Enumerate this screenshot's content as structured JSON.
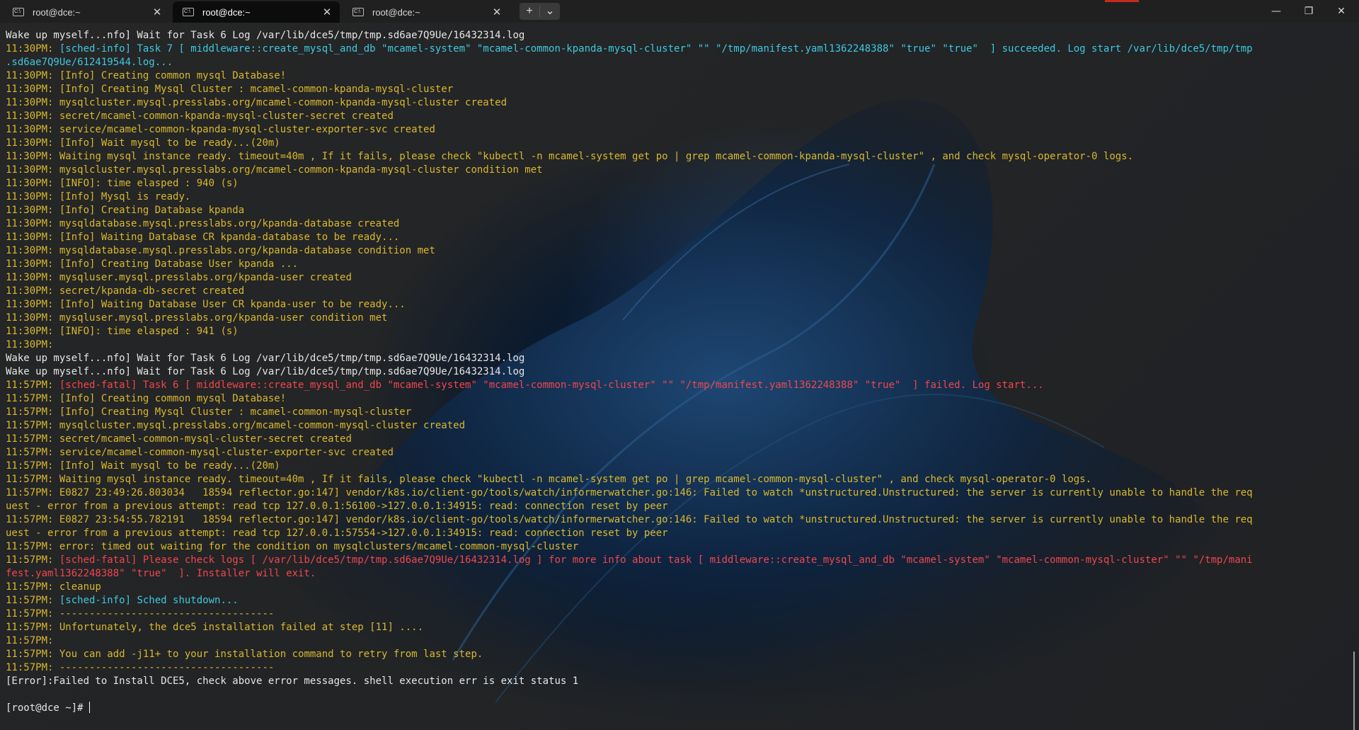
{
  "tabs": [
    {
      "label": "root@dce:~",
      "active": false
    },
    {
      "label": "root@dce:~",
      "active": true
    },
    {
      "label": "root@dce:~",
      "active": false
    }
  ],
  "controls": {
    "new_tab": "+",
    "dropdown": "⌄",
    "minimize": "—",
    "maximize": "❐",
    "close": "✕",
    "tab_close": "✕"
  },
  "terminal_lines": [
    {
      "time": "",
      "text": "Wake up myself...nfo] Wait for Task 6 Log /var/lib/dce5/tmp/tmp.sd6ae7Q9Ue/16432314.log",
      "color": "white"
    },
    {
      "time": "11:30PM:",
      "text": " [sched-info] Task 7 [ middleware::create_mysql_and_db \"mcamel-system\" \"mcamel-common-kpanda-mysql-cluster\" \"\" \"/tmp/manifest.yaml1362248388\" \"true\" \"true\"  ] succeeded. Log start /var/lib/dce5/tmp/tmp",
      "color": "cyan"
    },
    {
      "time": "",
      "text": ".sd6ae7Q9Ue/612419544.log...",
      "color": "cyan"
    },
    {
      "time": "11:30PM:",
      "text": " [Info] Creating common mysql Database!",
      "color": "yellow"
    },
    {
      "time": "11:30PM:",
      "text": " [Info] Creating Mysql Cluster : mcamel-common-kpanda-mysql-cluster",
      "color": "yellow"
    },
    {
      "time": "11:30PM:",
      "text": " mysqlcluster.mysql.presslabs.org/mcamel-common-kpanda-mysql-cluster created",
      "color": "yellow"
    },
    {
      "time": "11:30PM:",
      "text": " secret/mcamel-common-kpanda-mysql-cluster-secret created",
      "color": "yellow"
    },
    {
      "time": "11:30PM:",
      "text": " service/mcamel-common-kpanda-mysql-cluster-exporter-svc created",
      "color": "yellow"
    },
    {
      "time": "11:30PM:",
      "text": " [Info] Wait mysql to be ready...(20m)",
      "color": "yellow"
    },
    {
      "time": "11:30PM:",
      "text": " Waiting mysql instance ready. timeout=40m , If it fails, please check \"kubectl -n mcamel-system get po | grep mcamel-common-kpanda-mysql-cluster\" , and check mysql-operator-0 logs.",
      "color": "yellow"
    },
    {
      "time": "11:30PM:",
      "text": " mysqlcluster.mysql.presslabs.org/mcamel-common-kpanda-mysql-cluster condition met",
      "color": "yellow"
    },
    {
      "time": "11:30PM:",
      "text": " [INFO]: time elasped : 940 (s)",
      "color": "yellow"
    },
    {
      "time": "11:30PM:",
      "text": " [Info] Mysql is ready.",
      "color": "yellow"
    },
    {
      "time": "11:30PM:",
      "text": " [Info] Creating Database kpanda",
      "color": "yellow"
    },
    {
      "time": "11:30PM:",
      "text": " mysqldatabase.mysql.presslabs.org/kpanda-database created",
      "color": "yellow"
    },
    {
      "time": "11:30PM:",
      "text": " [Info] Waiting Database CR kpanda-database to be ready...",
      "color": "yellow"
    },
    {
      "time": "11:30PM:",
      "text": " mysqldatabase.mysql.presslabs.org/kpanda-database condition met",
      "color": "yellow"
    },
    {
      "time": "11:30PM:",
      "text": " [Info] Creating Database User kpanda ...",
      "color": "yellow"
    },
    {
      "time": "11:30PM:",
      "text": " mysqluser.mysql.presslabs.org/kpanda-user created",
      "color": "yellow"
    },
    {
      "time": "11:30PM:",
      "text": " secret/kpanda-db-secret created",
      "color": "yellow"
    },
    {
      "time": "11:30PM:",
      "text": " [Info] Waiting Database User CR kpanda-user to be ready...",
      "color": "yellow"
    },
    {
      "time": "11:30PM:",
      "text": " mysqluser.mysql.presslabs.org/kpanda-user condition met",
      "color": "yellow"
    },
    {
      "time": "11:30PM:",
      "text": " [INFO]: time elasped : 941 (s)",
      "color": "yellow"
    },
    {
      "time": "11:30PM:",
      "text": "",
      "color": "yellow"
    },
    {
      "time": "",
      "text": "Wake up myself...nfo] Wait for Task 6 Log /var/lib/dce5/tmp/tmp.sd6ae7Q9Ue/16432314.log",
      "color": "white"
    },
    {
      "time": "",
      "text": "Wake up myself...nfo] Wait for Task 6 Log /var/lib/dce5/tmp/tmp.sd6ae7Q9Ue/16432314.log",
      "color": "white"
    },
    {
      "time": "11:57PM:",
      "text": " [sched-fatal] Task 6 [ middleware::create_mysql_and_db \"mcamel-system\" \"mcamel-common-mysql-cluster\" \"\" \"/tmp/manifest.yaml1362248388\" \"true\"  ] failed. Log start...",
      "color": "red"
    },
    {
      "time": "11:57PM:",
      "text": " [Info] Creating common mysql Database!",
      "color": "yellow"
    },
    {
      "time": "11:57PM:",
      "text": " [Info] Creating Mysql Cluster : mcamel-common-mysql-cluster",
      "color": "yellow"
    },
    {
      "time": "11:57PM:",
      "text": " mysqlcluster.mysql.presslabs.org/mcamel-common-mysql-cluster created",
      "color": "yellow"
    },
    {
      "time": "11:57PM:",
      "text": " secret/mcamel-common-mysql-cluster-secret created",
      "color": "yellow"
    },
    {
      "time": "11:57PM:",
      "text": " service/mcamel-common-mysql-cluster-exporter-svc created",
      "color": "yellow"
    },
    {
      "time": "11:57PM:",
      "text": " [Info] Wait mysql to be ready...(20m)",
      "color": "yellow"
    },
    {
      "time": "11:57PM:",
      "text": " Waiting mysql instance ready. timeout=40m , If it fails, please check \"kubectl -n mcamel-system get po | grep mcamel-common-mysql-cluster\" , and check mysql-operator-0 logs.",
      "color": "yellow"
    },
    {
      "time": "11:57PM:",
      "text": " E0827 23:49:26.803034   18594 reflector.go:147] vendor/k8s.io/client-go/tools/watch/informerwatcher.go:146: Failed to watch *unstructured.Unstructured: the server is currently unable to handle the req",
      "color": "yellow"
    },
    {
      "time": "",
      "text": "uest - error from a previous attempt: read tcp 127.0.0.1:56100->127.0.0.1:34915: read: connection reset by peer",
      "color": "yellow"
    },
    {
      "time": "11:57PM:",
      "text": " E0827 23:54:55.782191   18594 reflector.go:147] vendor/k8s.io/client-go/tools/watch/informerwatcher.go:146: Failed to watch *unstructured.Unstructured: the server is currently unable to handle the req",
      "color": "yellow"
    },
    {
      "time": "",
      "text": "uest - error from a previous attempt: read tcp 127.0.0.1:57554->127.0.0.1:34915: read: connection reset by peer",
      "color": "yellow"
    },
    {
      "time": "11:57PM:",
      "text": " error: timed out waiting for the condition on mysqlclusters/mcamel-common-mysql-cluster",
      "color": "yellow"
    },
    {
      "time": "11:57PM:",
      "text": " [sched-fatal] Please check logs [ /var/lib/dce5/tmp/tmp.sd6ae7Q9Ue/16432314.log ] for more info about task [ middleware::create_mysql_and_db \"mcamel-system\" \"mcamel-common-mysql-cluster\" \"\" \"/tmp/mani",
      "color": "red"
    },
    {
      "time": "",
      "text": "fest.yaml1362248388\" \"true\"  ]. Installer will exit.",
      "color": "red"
    },
    {
      "time": "11:57PM:",
      "text": " cleanup",
      "color": "yellow"
    },
    {
      "time": "11:57PM:",
      "text": " [sched-info] Sched shutdown...",
      "color": "cyan"
    },
    {
      "time": "11:57PM:",
      "text": " ------------------------------------",
      "color": "yellow"
    },
    {
      "time": "11:57PM:",
      "text": " Unfortunately, the dce5 installation failed at step [11] ....",
      "color": "yellow"
    },
    {
      "time": "11:57PM:",
      "text": "",
      "color": "yellow"
    },
    {
      "time": "11:57PM:",
      "text": " You can add -j11+ to your installation command to retry from last step.",
      "color": "yellow"
    },
    {
      "time": "11:57PM:",
      "text": " ------------------------------------",
      "color": "yellow"
    },
    {
      "time": "",
      "text": "[Error]:Failed to Install DCE5, check above error messages. shell execution err is exit status 1",
      "color": "white"
    },
    {
      "time": "",
      "text": "",
      "color": "white"
    },
    {
      "time": "",
      "text": "[root@dce ~]# ",
      "color": "white",
      "prompt": true
    }
  ],
  "colors": {
    "white": "#e6e6e6",
    "yellow": "#d8b82e",
    "cyan": "#3fc8e0",
    "red": "#f0464e",
    "accent": "#c42b1c"
  }
}
